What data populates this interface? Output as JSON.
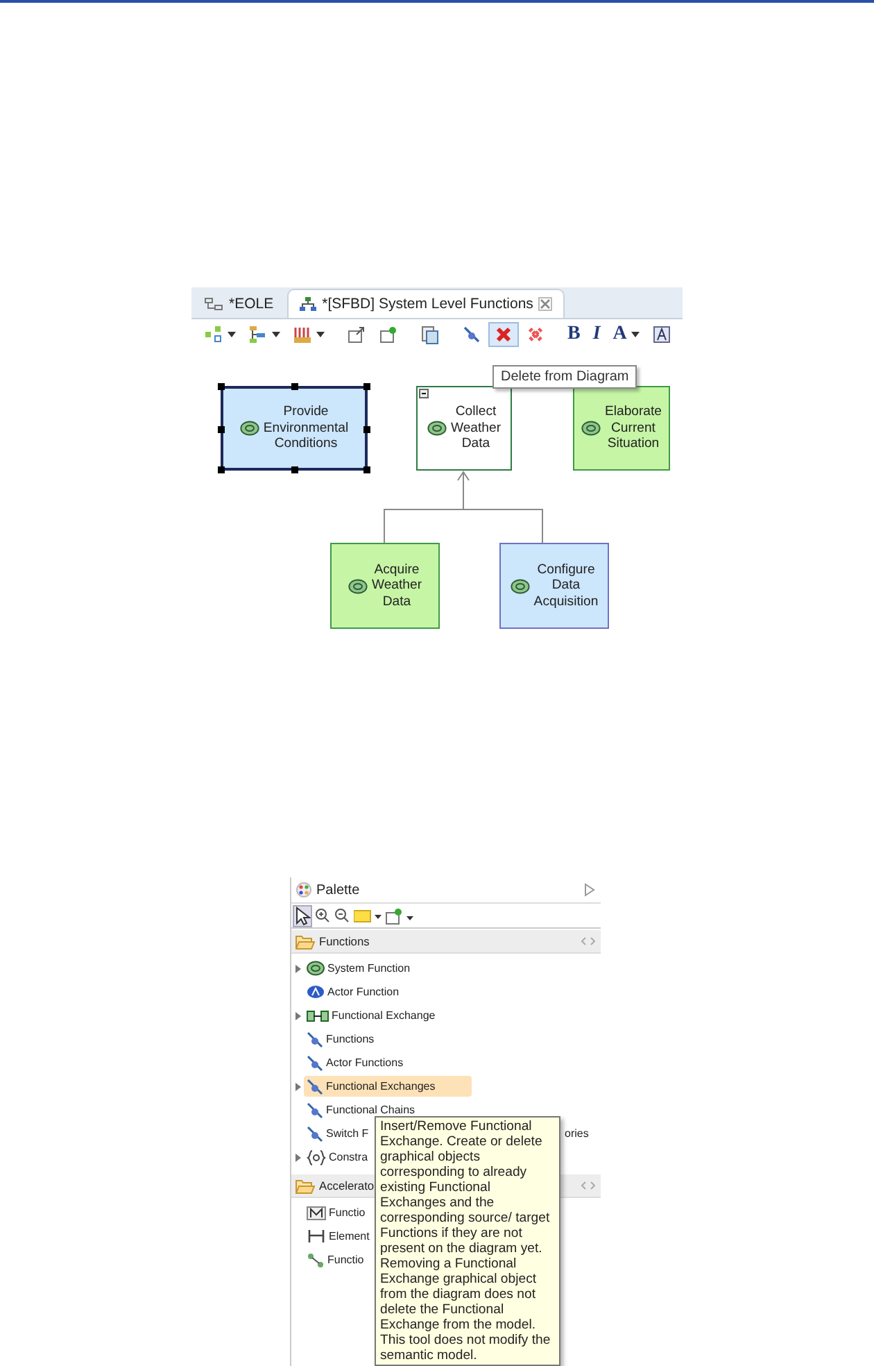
{
  "editor": {
    "tabs": [
      {
        "label": "*EOLE",
        "selected": false,
        "kind": "diagram"
      },
      {
        "label": "*[SFBD] System Level Functions",
        "selected": true,
        "kind": "sfbd"
      }
    ],
    "toolbar": [
      {
        "kind": "arrange",
        "dropdown": true,
        "highlighted": false
      },
      {
        "kind": "layout",
        "dropdown": true,
        "highlighted": false
      },
      {
        "kind": "filters",
        "dropdown": true,
        "highlighted": false
      },
      {
        "kind": "separator"
      },
      {
        "kind": "export",
        "dropdown": false,
        "highlighted": false
      },
      {
        "kind": "pin",
        "dropdown": false,
        "highlighted": false
      },
      {
        "kind": "separator"
      },
      {
        "kind": "copy",
        "dropdown": false,
        "highlighted": false
      },
      {
        "kind": "separator"
      },
      {
        "kind": "hide",
        "dropdown": false,
        "highlighted": false
      },
      {
        "kind": "delete",
        "dropdown": false,
        "highlighted": true
      },
      {
        "kind": "delete-model",
        "dropdown": false,
        "highlighted": false
      },
      {
        "kind": "separator"
      },
      {
        "kind": "bold",
        "text": "B",
        "dropdown": false,
        "highlighted": false
      },
      {
        "kind": "italic",
        "text": "I",
        "dropdown": false,
        "highlighted": false
      },
      {
        "kind": "font",
        "text": "A",
        "dropdown": true,
        "highlighted": false
      },
      {
        "kind": "fontstyle",
        "dropdown": false,
        "highlighted": false
      },
      {
        "kind": "separator"
      }
    ],
    "nodes": [
      {
        "lines": [
          "Provide",
          "Environmental",
          "Conditions"
        ],
        "color": "#cce6fc",
        "selected": true,
        "collapsible": false
      },
      {
        "lines": [
          "Collect",
          "Weather",
          "Data"
        ],
        "color": "#ffffff",
        "selected": false,
        "collapsible": true
      },
      {
        "lines": [
          "Elaborate",
          "Current",
          "Situation"
        ],
        "color": "#c6f5a6",
        "selected": false,
        "collapsible": false
      },
      {
        "lines": [
          "Acquire",
          "Weather",
          "Data"
        ],
        "color": "#c6f5a6",
        "selected": false,
        "collapsible": false
      },
      {
        "lines": [
          "Configure",
          "Data",
          "Acquisition"
        ],
        "color": "#cce6fc",
        "selected": false,
        "collapsible": false
      }
    ],
    "tooltip": "Delete from Diagram"
  },
  "palette": {
    "title": "Palette",
    "drawers": [
      {
        "title": "Functions",
        "items": [
          {
            "label": "System Function",
            "kind": "function",
            "expandable": true,
            "selected": false
          },
          {
            "label": "Actor Function",
            "kind": "actor",
            "expandable": false,
            "selected": false
          },
          {
            "label": "Functional Exchange",
            "kind": "exchange",
            "expandable": true,
            "selected": false
          },
          {
            "label": "Functions",
            "kind": "insert",
            "expandable": false,
            "selected": false
          },
          {
            "label": "Actor Functions",
            "kind": "insert",
            "expandable": false,
            "selected": false
          },
          {
            "label": "Functional Exchanges",
            "kind": "insert",
            "expandable": true,
            "selected": true
          },
          {
            "label": "Functional Chains",
            "kind": "insert",
            "expandable": false,
            "selected": false
          },
          {
            "label": "Switch F",
            "tail": "ories",
            "kind": "insert",
            "expandable": false,
            "selected": false
          },
          {
            "label": "Constra",
            "kind": "constraint",
            "expandable": true,
            "selected": false
          }
        ]
      },
      {
        "title": "Accelerato",
        "items": [
          {
            "label": "Functio",
            "kind": "model",
            "expandable": false,
            "selected": false
          },
          {
            "label": "Element",
            "kind": "element",
            "expandable": false,
            "selected": false
          },
          {
            "label": "Functio",
            "kind": "chain",
            "expandable": false,
            "selected": false
          }
        ]
      }
    ],
    "tooltip": "Insert/Remove Functional Exchange. Create or delete graphical objects corresponding to already existing Functional Exchanges and the corresponding source/ target Functions if they are not present on the diagram yet. Removing a Functional Exchange graphical object from the diagram does not delete the Functional Exchange from the model. This tool does not modify the semantic model."
  }
}
